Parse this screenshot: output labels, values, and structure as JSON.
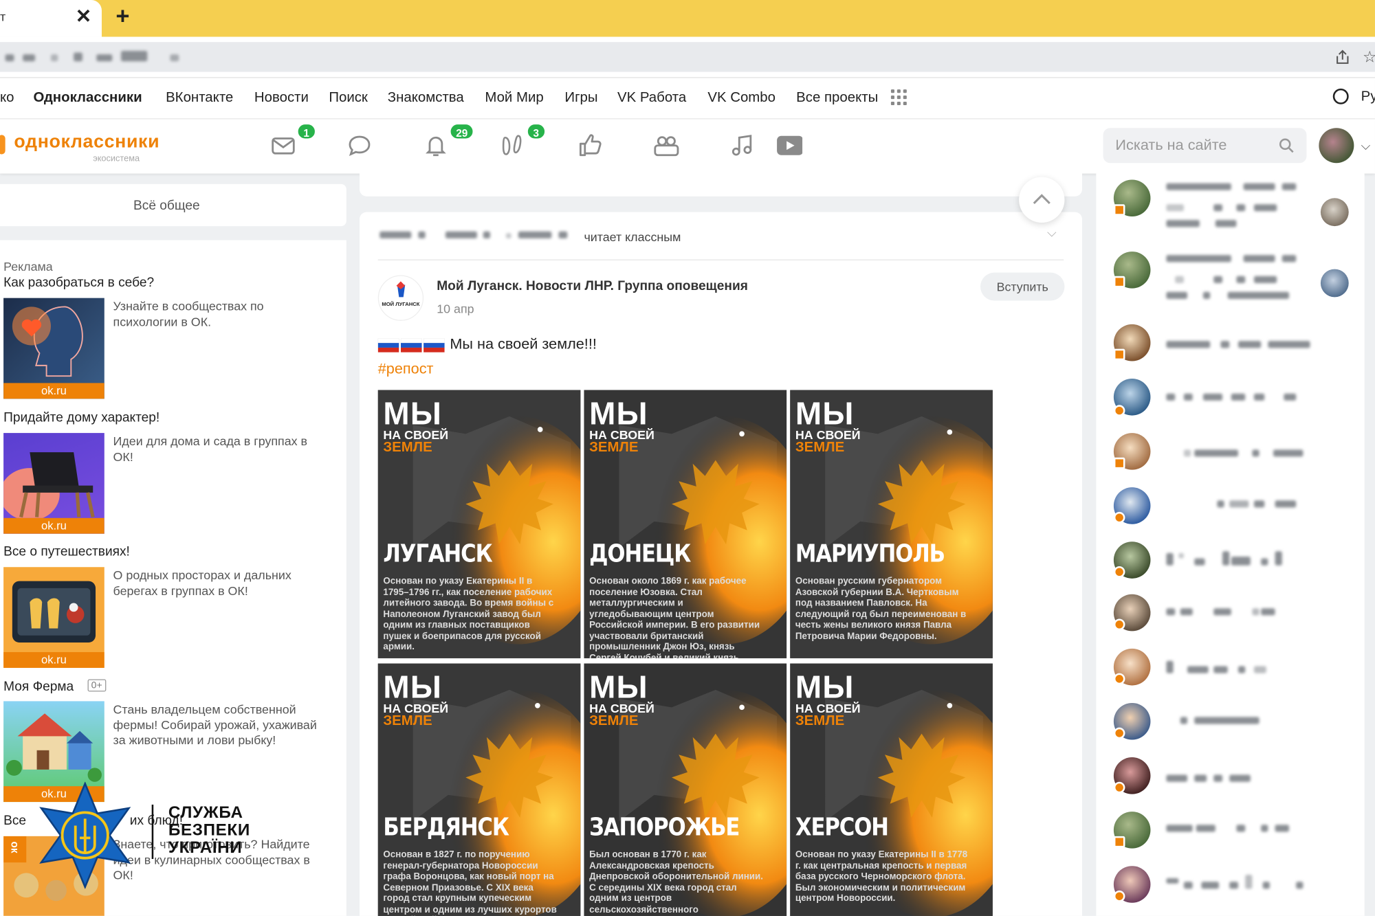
{
  "browser": {
    "tab_title": "т",
    "tab_close": "✕",
    "new_tab": "+",
    "star": "☆"
  },
  "projects_bar": {
    "items": [
      {
        "label": "ко",
        "bold": false
      },
      {
        "label": "Одноклассники",
        "bold": true
      },
      {
        "label": "ВКонтакте",
        "bold": false
      },
      {
        "label": "Новости",
        "bold": false
      },
      {
        "label": "Поиск",
        "bold": false
      },
      {
        "label": "Знакомства",
        "bold": false
      },
      {
        "label": "Мой Мир",
        "bold": false
      },
      {
        "label": "Игры",
        "bold": false
      },
      {
        "label": "VK Работа",
        "bold": false
      },
      {
        "label": "VK Combo",
        "bold": false
      },
      {
        "label": "Все проекты",
        "bold": false
      }
    ],
    "language": "Ру"
  },
  "header": {
    "logo": "одноклассники",
    "logo_sub": "экосистема",
    "nav": [
      {
        "name": "messages-icon",
        "badge": "1"
      },
      {
        "name": "discussions-icon",
        "badge": ""
      },
      {
        "name": "notifications-icon",
        "badge": "29"
      },
      {
        "name": "guests-icon",
        "badge": "3"
      },
      {
        "name": "likes-icon",
        "badge": ""
      },
      {
        "name": "friends-icon",
        "badge": ""
      },
      {
        "name": "music-icon",
        "badge": ""
      },
      {
        "name": "video-icon",
        "badge": ""
      }
    ],
    "search_placeholder": "Искать на сайте"
  },
  "left": {
    "all_common": "Всё общее",
    "ads_label": "Реклама",
    "ads": [
      {
        "title": "Как разобраться в себе?",
        "desc": "Узнайте в сообществах по психологии в ОК.",
        "source": "ok.ru"
      },
      {
        "title": "Придайте дому характер!",
        "desc": "Идеи для дома и сада в группах в ОК!",
        "source": "ok.ru"
      },
      {
        "title": "Все о путешествиях!",
        "desc": "О родных просторах и дальних берегах в группах в ОК!",
        "source": "ok.ru"
      },
      {
        "title": "Моя Ферма",
        "age": "0+",
        "desc": "Стань владельцем собственной фермы! Собирай урожай, ухаживай за животными и лови рыбку!",
        "source": "ok.ru"
      },
      {
        "title": "Все",
        "title_end": "их блюд!",
        "desc": "Знаете, что приготовить? Найдите идеи в кулинарных сообществах в ОК!",
        "source": "ок"
      }
    ],
    "watermark": [
      "СЛУЖБА",
      "БЕЗПЕКИ",
      "УКРАЇНИ"
    ]
  },
  "post": {
    "reaction": "читает классным",
    "group_name": "Мой Луганск. Новости ЛНР. Группа оповещения",
    "group_logo_text": "МОЙ ЛУГАНСК",
    "date": "10 апр",
    "join": "Вступить",
    "text": "Мы на своей земле!!!",
    "hashtag": "#репост",
    "tile_title": [
      "МЫ",
      "НА СВОЕЙ",
      "ЗЕМЛЕ"
    ],
    "tiles": [
      {
        "city": "ЛУГАНСК",
        "blurb": "Основан по указу Екатерины II в 1795–1796 гг., как поселение рабочих литейного завода. Во время войны с Наполеоном Луганский завод был одним из главных поставщиков пушек и боеприпасов для русской армии."
      },
      {
        "city": "ДОНЕЦК",
        "blurb": "Основан около 1869 г. как рабочее поселение Юзовка. Стал металлургическим и угледобывающим центром Российской империи. В его развитии участвовали британский промышленник Джон Юз, князь Сергей Кочубей и великий князь Константин Николаевич."
      },
      {
        "city": "МАРИУПОЛЬ",
        "blurb": "Основан русским губернатором Азовской губернии В.А. Чертковым под названием Павловск. На следующий год был переименован в честь жены великого князя Павла Петровича Марии Федоровны."
      },
      {
        "city": "БЕРДЯНСК",
        "blurb": "Основан в 1827 г. по поручению генерал-губернатора Новороссии графа Воронцова, как новый порт на Северном Приазовье. С XIX века город стал крупным купеческим центром и одним из лучших курортов Российской империи."
      },
      {
        "city": "ЗАПОРОЖЬЕ",
        "blurb": "Был основан в 1770 г. как Александровская крепость Днепровской оборонительной линии. С середины XIX века город стал одним из центров сельскохозяйственного машиностроения России."
      },
      {
        "city": "ХЕРСОН",
        "blurb": "Основан по указу Екатерины II в 1778 г. как центральная крепость и первая база русского Черноморского флота. Был экономическим и политическим центром Новороссии."
      }
    ]
  },
  "colors": {
    "brand": "#ee8208",
    "tab_bar": "#f5cf50",
    "badge": "#27b34a",
    "page_bg": "#eef0f2"
  }
}
